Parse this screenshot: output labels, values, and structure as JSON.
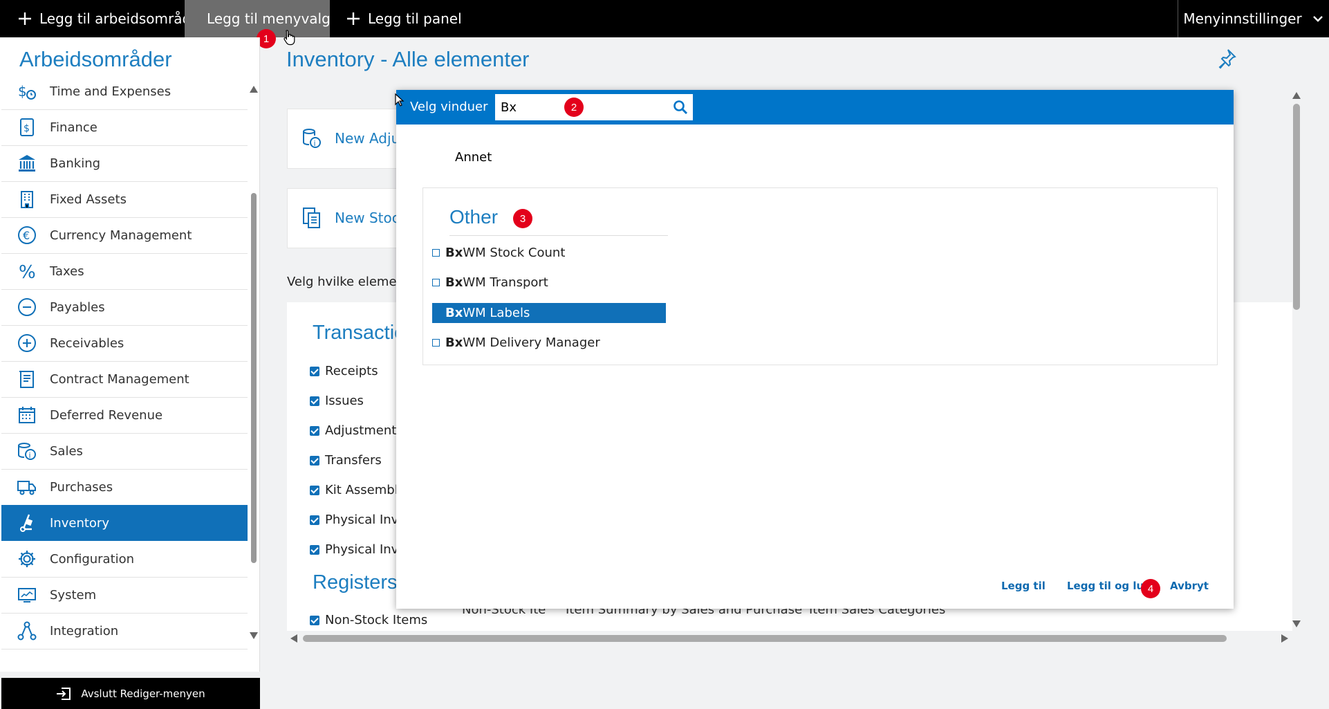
{
  "topbar": {
    "add_workspace": "Legg til arbeidsområde",
    "add_menu_item": "Legg til menyvalg",
    "add_panel": "Legg til panel",
    "menu_settings": "Menyinnstillinger"
  },
  "badges": [
    "1",
    "2",
    "3",
    "4"
  ],
  "sidebar": {
    "title": "Arbeidsområder",
    "items": [
      {
        "label": "Time and Expenses",
        "icon": "time-expenses-icon"
      },
      {
        "label": "Finance",
        "icon": "finance-icon"
      },
      {
        "label": "Banking",
        "icon": "bank-icon"
      },
      {
        "label": "Fixed Assets",
        "icon": "building-icon"
      },
      {
        "label": "Currency Management",
        "icon": "euro-icon"
      },
      {
        "label": "Taxes",
        "icon": "percent-icon"
      },
      {
        "label": "Payables",
        "icon": "minus-circle-icon"
      },
      {
        "label": "Receivables",
        "icon": "plus-circle-icon"
      },
      {
        "label": "Contract Management",
        "icon": "contract-icon"
      },
      {
        "label": "Deferred Revenue",
        "icon": "calendar-icon"
      },
      {
        "label": "Sales",
        "icon": "coins-icon"
      },
      {
        "label": "Purchases",
        "icon": "truck-icon"
      },
      {
        "label": "Inventory",
        "icon": "dolly-icon"
      },
      {
        "label": "Configuration",
        "icon": "gear-icon"
      },
      {
        "label": "System",
        "icon": "monitor-icon"
      },
      {
        "label": "Integration",
        "icon": "network-icon"
      }
    ],
    "selected": "Inventory",
    "footer": "Avslutt Rediger-menyen"
  },
  "main": {
    "title": "Inventory - Alle elementer",
    "cards": [
      "New Adju",
      "New Stock"
    ],
    "choose_text": "Velg hvilke element",
    "sections": [
      "Transactio",
      "Registers"
    ],
    "transactions": [
      "Receipts",
      "Issues",
      "Adjustments",
      "Transfers",
      "Kit Assembly",
      "Physical Inve",
      "Physical Inve"
    ],
    "registers": [
      "Non-Stock Items"
    ],
    "under_text": [
      "Non-Stock Ite",
      "Item Summary by Sales and Purchase",
      "Item Sales Categories"
    ]
  },
  "dialog": {
    "title": "Velg vinduer",
    "search_value": "Bx",
    "category": "Annet",
    "group_title": "Other",
    "options": [
      {
        "prefix": "Bx",
        "rest": "WM Stock Count",
        "highlighted": false
      },
      {
        "prefix": "Bx",
        "rest": "WM Transport",
        "highlighted": false
      },
      {
        "prefix": "Bx",
        "rest": "WM Labels",
        "highlighted": true
      },
      {
        "prefix": "Bx",
        "rest": "WM Delivery Manager",
        "highlighted": false
      }
    ],
    "buttons": {
      "add": "Legg til",
      "add_close": "Legg til og lukk",
      "cancel": "Avbryt"
    }
  },
  "colors": {
    "accent": "#1070b8",
    "header_blue": "#0075c9",
    "badge_red": "#e3001b",
    "title_blue": "#1d7ec0"
  }
}
